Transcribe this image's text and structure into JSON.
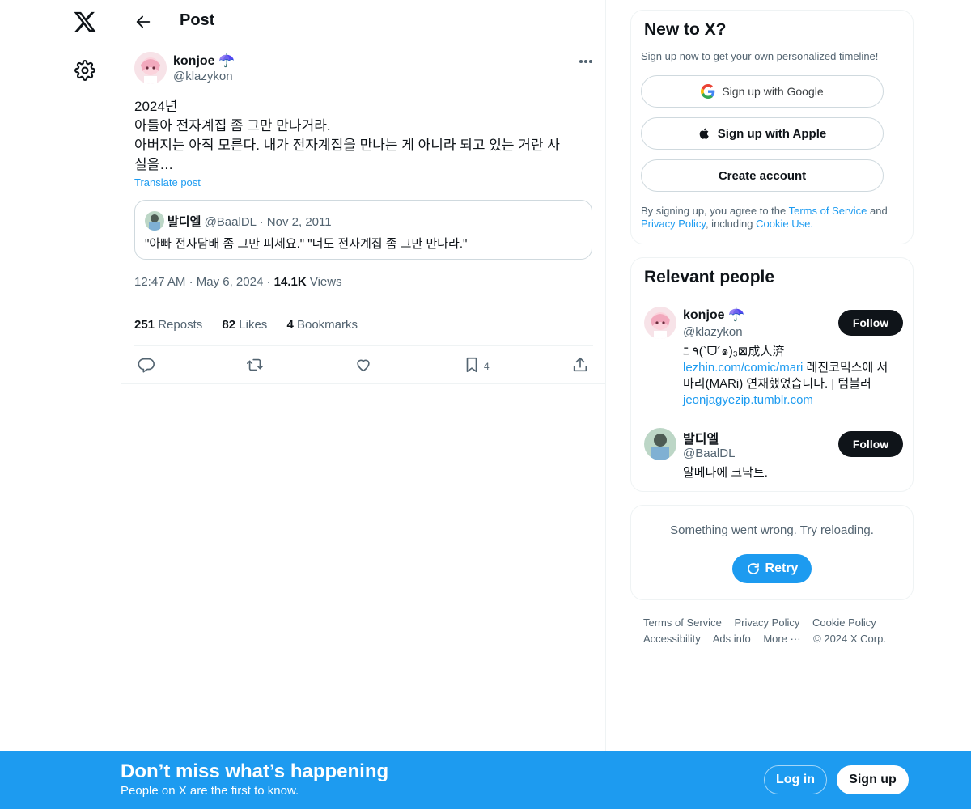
{
  "header": {
    "title": "Post"
  },
  "post": {
    "author_name": "konjoe",
    "author_emoji": "☂️",
    "author_handle": "@klazykon",
    "lines": [
      "2024년",
      "아들아 전자계집 좀 그만 만나거라.",
      "아버지는 아직 모른다. 내가 전자계집을 만나는 게 아니라 되고 있는 거란 사",
      "실을…"
    ],
    "translate_label": "Translate post",
    "quote": {
      "name": "발디엘",
      "handle": "@BaalDL",
      "separator": "·",
      "date": "Nov 2, 2011",
      "text": "\"아빠 전자담배 좀 그만 피세요.\" \"너도 전자계집 좀 그만 만나라.\""
    },
    "time": "12:47 AM",
    "dot": "·",
    "date": "May 6, 2024",
    "views_count": "14.1K",
    "views_label": "Views",
    "reposts_count": "251",
    "reposts_label": "Reposts",
    "likes_count": "82",
    "likes_label": "Likes",
    "bookmarks_count": "4",
    "bookmarks_label": "Bookmarks",
    "bookmark_action_count": "4"
  },
  "signup_card": {
    "title": "New to X?",
    "subtitle": "Sign up now to get your own personalized timeline!",
    "google_label": "Sign up with Google",
    "apple_label": "Sign up with Apple",
    "create_label": "Create account",
    "legal_1": "By signing up, you agree to the ",
    "terms": "Terms of Service",
    "legal_2": " and ",
    "privacy": "Privacy Policy",
    "legal_3": ", including ",
    "cookie": "Cookie Use."
  },
  "relevant": {
    "title": "Relevant people",
    "people": [
      {
        "name": "konjoe",
        "emoji": "☂️",
        "handle": "@klazykon",
        "follow": "Follow",
        "bio_line1": "ﾆ  ٩(`ᗜ´๑)₃⊠成人済",
        "bio_link1": "lezhin.com/comic/mari",
        "bio_text2": " 레진코믹스에 서 마리(MARi) 연재했었습니다. | 텀블러 ",
        "bio_link2": "jeonjagyezip.tumblr.com"
      },
      {
        "name": "발디엘",
        "handle": "@BaalDL",
        "follow": "Follow",
        "bio": "알메나에 크낙트."
      }
    ]
  },
  "error_card": {
    "message": "Something went wrong. Try reloading.",
    "retry": "Retry"
  },
  "footer": {
    "links": [
      "Terms of Service",
      "Privacy Policy",
      "Cookie Policy",
      "Accessibility",
      "Ads info",
      "More ···"
    ],
    "copyright": "© 2024 X Corp."
  },
  "bottom_bar": {
    "title": "Don’t miss what’s happening",
    "subtitle": "People on X are the first to know.",
    "login": "Log in",
    "signup": "Sign up"
  }
}
